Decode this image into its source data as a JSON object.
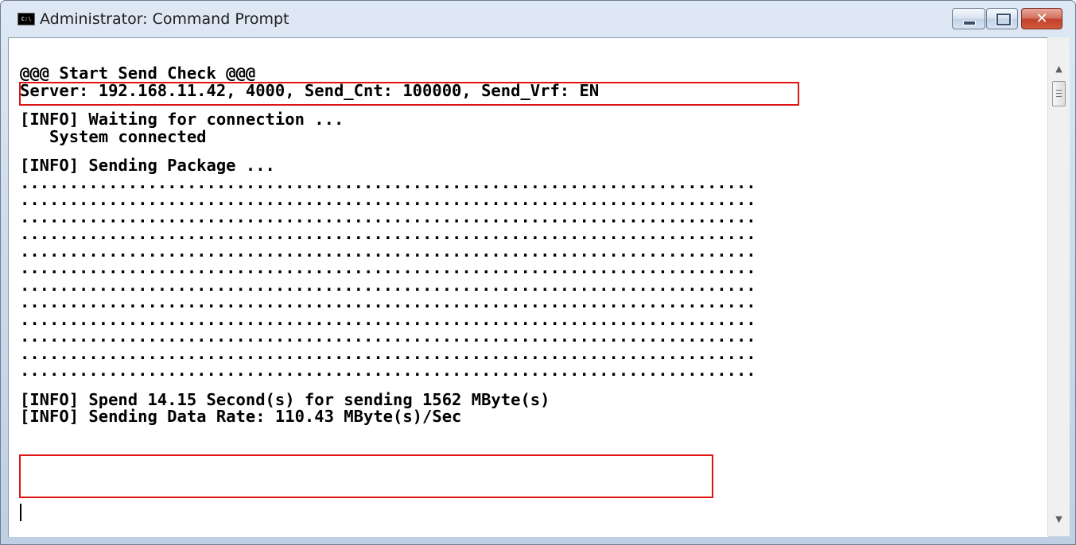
{
  "window": {
    "icon_label": "C:\\",
    "title": "Administrator: Command Prompt",
    "close_glyph": "✕"
  },
  "console": {
    "lines": [
      {
        "text": "@@@ Start Send Check @@@",
        "gap_before": false
      },
      {
        "text": "Server: 192.168.11.42, 4000, Send_Cnt: 100000, Send_Vrf: EN",
        "gap_before": false
      },
      {
        "text": "[INFO] Waiting for connection ...",
        "gap_before": true
      },
      {
        "text": "   System connected",
        "gap_before": false
      },
      {
        "text": "[INFO] Sending Package ...",
        "gap_before": true
      },
      {
        "text": "...........................................................................",
        "gap_before": false
      },
      {
        "text": "...........................................................................",
        "gap_before": false
      },
      {
        "text": "...........................................................................",
        "gap_before": false
      },
      {
        "text": "...........................................................................",
        "gap_before": false
      },
      {
        "text": "...........................................................................",
        "gap_before": false
      },
      {
        "text": "...........................................................................",
        "gap_before": false
      },
      {
        "text": "...........................................................................",
        "gap_before": false
      },
      {
        "text": "...........................................................................",
        "gap_before": false
      },
      {
        "text": "...........................................................................",
        "gap_before": false
      },
      {
        "text": "...........................................................................",
        "gap_before": false
      },
      {
        "text": "...........................................................................",
        "gap_before": false
      },
      {
        "text": "...........................................................................",
        "gap_before": false
      },
      {
        "text": "[INFO] Spend 14.15 Second(s) for sending 1562 MByte(s)",
        "gap_before": true
      },
      {
        "text": "[INFO] Sending Data Rate: 110.43 MByte(s)/Sec",
        "gap_before": false
      }
    ]
  },
  "colors": {
    "highlight": "#e01313",
    "console_bg": "#ffffff",
    "console_fg": "#000000"
  },
  "icons": {
    "scroll_up": "up-arrow-icon",
    "scroll_down": "down-arrow-icon"
  }
}
